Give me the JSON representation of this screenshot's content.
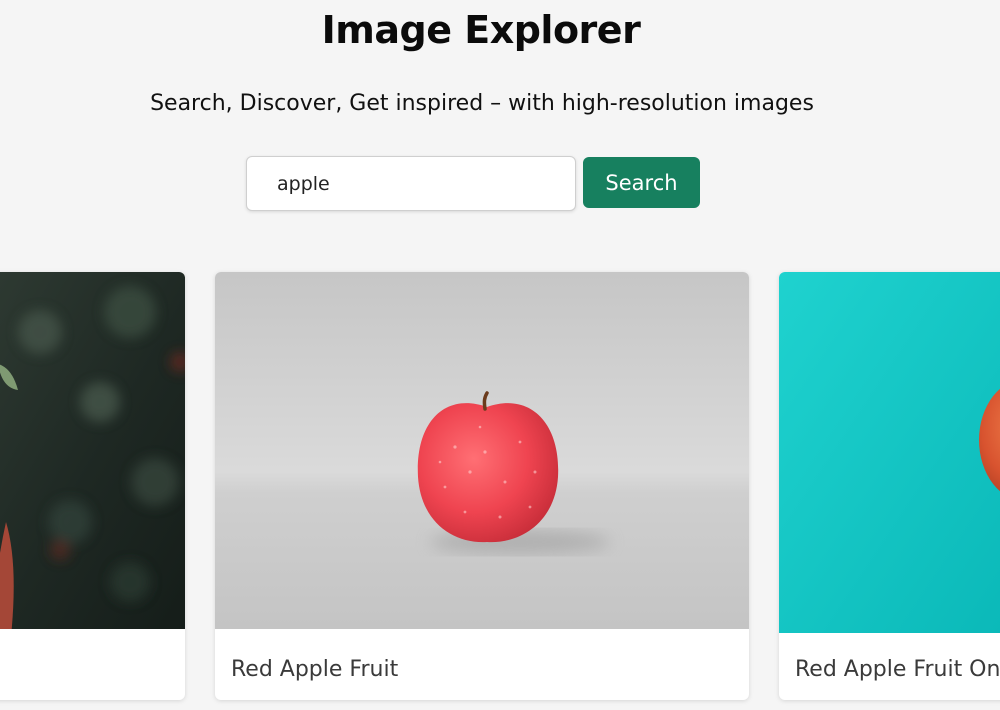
{
  "header": {
    "title": "Image Explorer",
    "subtitle": "Search, Discover, Get inspired – with high-resolution images"
  },
  "search": {
    "value": "apple",
    "button_label": "Search"
  },
  "results": [
    {
      "caption": ""
    },
    {
      "caption": "Red Apple Fruit"
    },
    {
      "caption": "Red Apple Fruit On"
    }
  ],
  "colors": {
    "background": "#f5f5f5",
    "accent": "#17805f"
  }
}
